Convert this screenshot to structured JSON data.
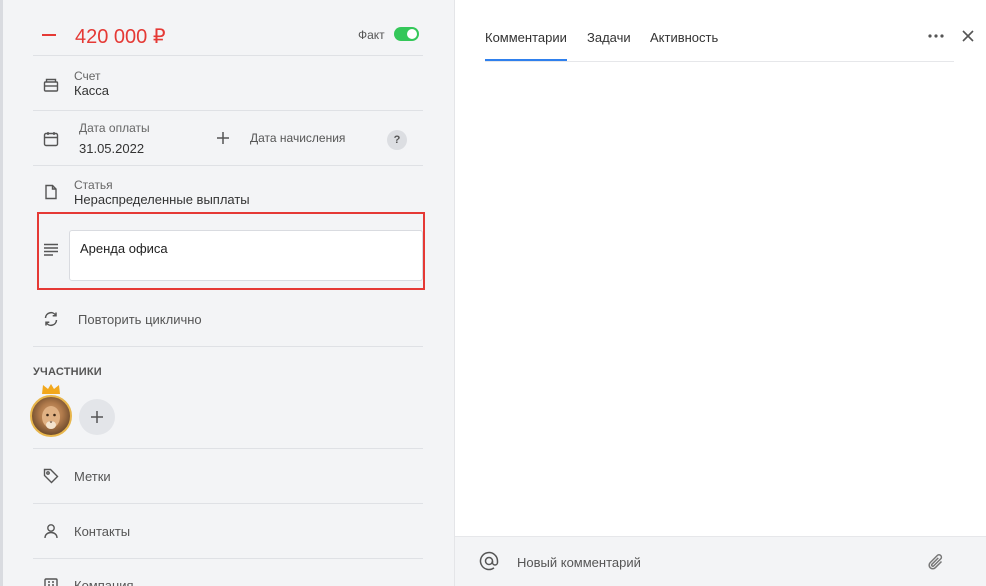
{
  "transaction": {
    "amount": "420 000 ₽",
    "fact_label": "Факт",
    "fact_enabled": true
  },
  "fields": {
    "account": {
      "label": "Счет",
      "value": "Касса"
    },
    "payment_date": {
      "label": "Дата оплаты",
      "value": "31.05.2022"
    },
    "accrual_date": {
      "label": "Дата начисления",
      "help": "?"
    },
    "category": {
      "label": "Статья",
      "value": "Нераспределенные выплаты"
    },
    "description": {
      "value": "Аренда офиса"
    },
    "repeat": {
      "label": "Повторить циклично"
    },
    "tags": {
      "label": "Метки"
    },
    "contacts": {
      "label": "Контакты"
    },
    "company": {
      "label": "Компания"
    }
  },
  "participants": {
    "title": "УЧАСТНИКИ"
  },
  "right_panel": {
    "tabs": [
      {
        "label": "Комментарии",
        "active": true
      },
      {
        "label": "Задачи",
        "active": false
      },
      {
        "label": "Активность",
        "active": false
      }
    ],
    "comment_placeholder": "Новый комментарий"
  },
  "colors": {
    "expense_red": "#e53935",
    "toggle_green": "#34c759",
    "tab_active_blue": "#2f80ed",
    "highlight_red": "#e53935"
  },
  "icons": {
    "account": "wallet-icon",
    "payment_date": "calendar-icon",
    "category": "document-icon",
    "description": "text-lines-icon",
    "repeat": "repeat-icon",
    "tags": "tag-icon",
    "contacts": "person-icon",
    "company": "building-icon"
  }
}
